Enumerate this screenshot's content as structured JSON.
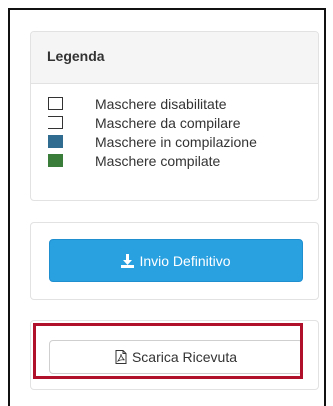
{
  "legend": {
    "title": "Legenda",
    "items": [
      {
        "label": "Maschere disabilitate",
        "icon": "empty-box",
        "color": "#ffffff"
      },
      {
        "label": "Maschere da compilare",
        "icon": "open-box",
        "color": "#ffffff"
      },
      {
        "label": "Maschere in compilazione",
        "icon": "blue-box",
        "color": "#2f6c8f"
      },
      {
        "label": "Maschere compilate",
        "icon": "green-box",
        "color": "#3a7d3a"
      }
    ]
  },
  "actions": {
    "send_label": "Invio Definitivo",
    "send_icon": "download-icon",
    "send_color": "#29a0e0",
    "receipt_label": "Scarica Ricevuta",
    "receipt_icon": "pdf-file-icon",
    "highlight_color": "#b0102a"
  }
}
